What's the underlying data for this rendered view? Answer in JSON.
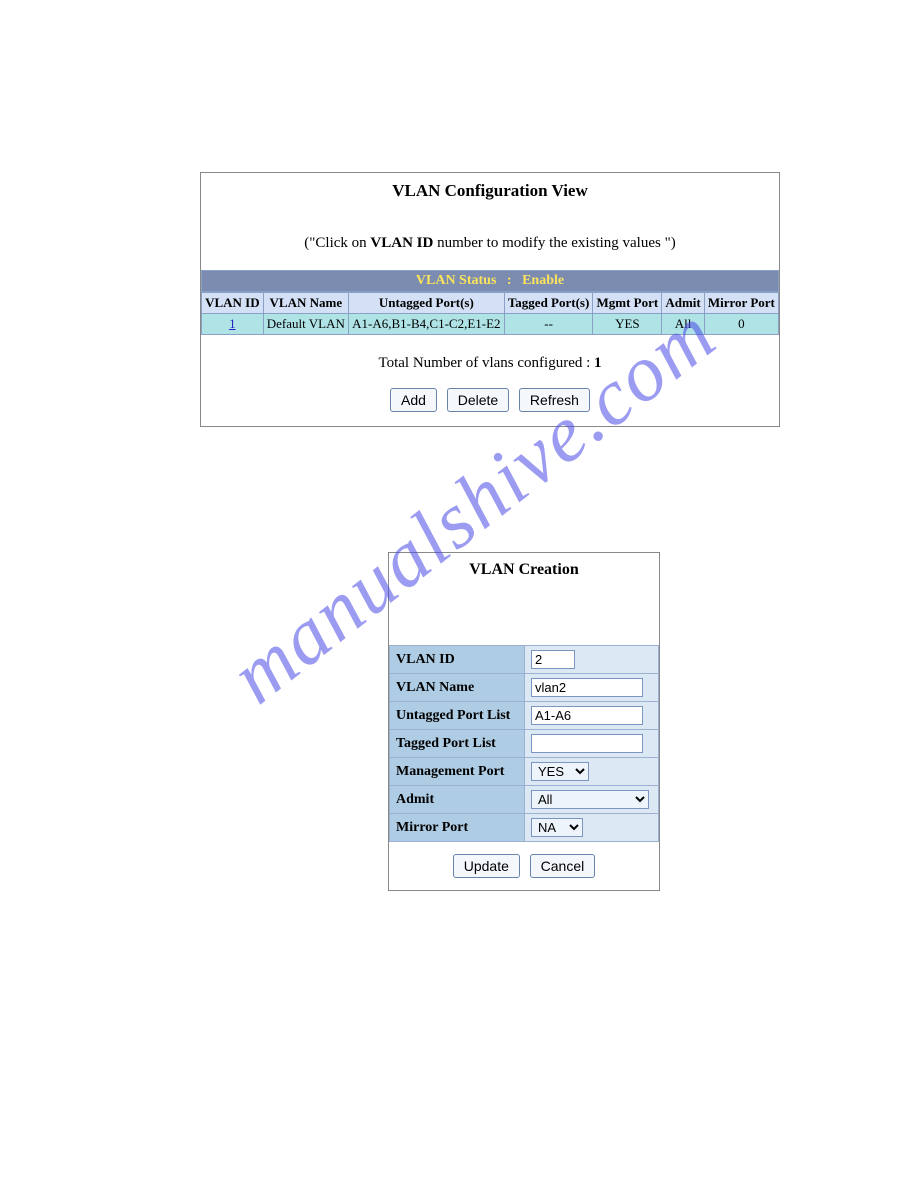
{
  "watermark": "manualshive.com",
  "config_view": {
    "title": "VLAN Configuration View",
    "hint_prefix": "(\"Click on ",
    "hint_bold": "VLAN ID",
    "hint_suffix": " number to modify the existing values \")",
    "status_label": "VLAN Status",
    "status_sep": ":",
    "status_value": "Enable",
    "headers": {
      "vlan_id": "VLAN ID",
      "vlan_name": "VLAN Name",
      "untagged": "Untagged Port(s)",
      "tagged": "Tagged Port(s)",
      "mgmt": "Mgmt Port",
      "admit": "Admit",
      "mirror": "Mirror Port"
    },
    "rows": [
      {
        "id": "1",
        "name": "Default VLAN",
        "untagged": "A1-A6,B1-B4,C1-C2,E1-E2",
        "tagged": "--",
        "mgmt": "YES",
        "admit": "All",
        "mirror": "0"
      }
    ],
    "total_prefix": "Total Number of vlans configured : ",
    "total_value": "1",
    "buttons": {
      "add": "Add",
      "delete": "Delete",
      "refresh": "Refresh"
    }
  },
  "creation": {
    "title": "VLAN Creation",
    "labels": {
      "vlan_id": "VLAN ID",
      "vlan_name": "VLAN Name",
      "untagged": "Untagged Port List",
      "tagged": "Tagged Port List",
      "mgmt": "Management Port",
      "admit": "Admit",
      "mirror": "Mirror Port"
    },
    "values": {
      "vlan_id": "2",
      "vlan_name": "vlan2",
      "untagged": "A1-A6",
      "tagged": "",
      "mgmt": "YES",
      "admit": "All",
      "mirror": "NA"
    },
    "buttons": {
      "update": "Update",
      "cancel": "Cancel"
    }
  }
}
